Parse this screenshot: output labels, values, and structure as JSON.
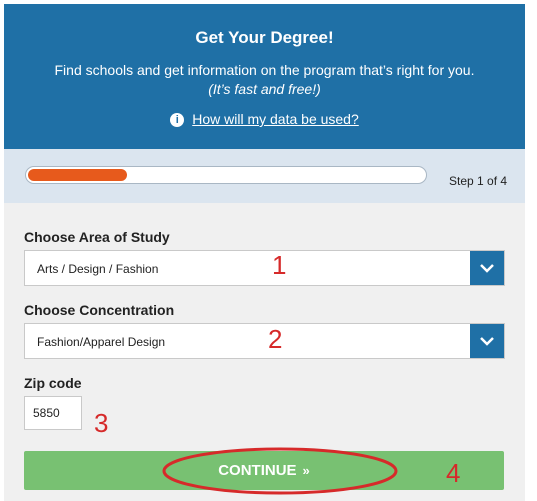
{
  "header": {
    "title": "Get Your Degree!",
    "subtitle": "Find schools and get information on the program that’s right for you.",
    "subnote": "(It’s fast and free!)",
    "info_icon": "info-icon",
    "info_link": "How will my data be used?",
    "background": "#1f70a6"
  },
  "progress": {
    "fraction": 0.25,
    "step_text": "Step 1 of 4",
    "fill_color": "#e75a1c"
  },
  "form": {
    "area_label": "Choose Area of Study",
    "area_value": "Arts / Design / Fashion",
    "concentration_label": "Choose Concentration",
    "concentration_value": "Fashion/Apparel Design",
    "zip_label": "Zip code",
    "zip_value": "5850",
    "continue_label": "CONTINUE",
    "continue_color": "#78c172"
  },
  "annotations": {
    "n1": "1",
    "n2": "2",
    "n3": "3",
    "n4": "4",
    "color": "#d62a2a"
  }
}
